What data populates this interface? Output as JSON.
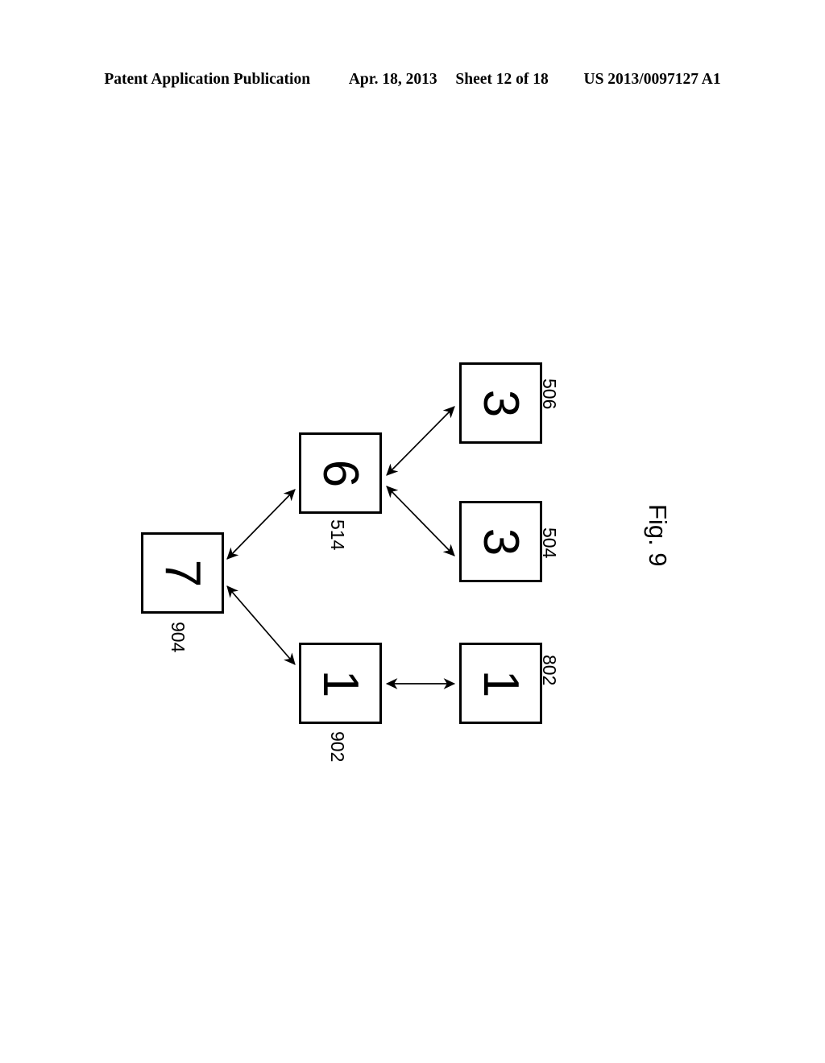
{
  "header": {
    "publication": "Patent Application Publication",
    "date": "Apr. 18, 2013",
    "sheet": "Sheet 12 of 18",
    "docket": "US 2013/0097127 A1"
  },
  "figure": {
    "caption": "Fig. 9",
    "nodes": [
      {
        "id": "506",
        "digit": "3",
        "ref": "506"
      },
      {
        "id": "514",
        "digit": "6",
        "ref": "514"
      },
      {
        "id": "504",
        "digit": "3",
        "ref": "504"
      },
      {
        "id": "904",
        "digit": "7",
        "ref": "904"
      },
      {
        "id": "902",
        "digit": "1",
        "ref": "902"
      },
      {
        "id": "802",
        "digit": "1",
        "ref": "802"
      }
    ],
    "connections": [
      {
        "from": "904",
        "to": "514",
        "arrow": "double"
      },
      {
        "from": "904",
        "to": "902",
        "arrow": "double"
      },
      {
        "from": "514",
        "to": "506",
        "arrow": "double"
      },
      {
        "from": "514",
        "to": "504",
        "arrow": "double"
      },
      {
        "from": "902",
        "to": "802",
        "arrow": "double"
      }
    ],
    "stroke_color": "#000000",
    "background_color": "#ffffff"
  }
}
